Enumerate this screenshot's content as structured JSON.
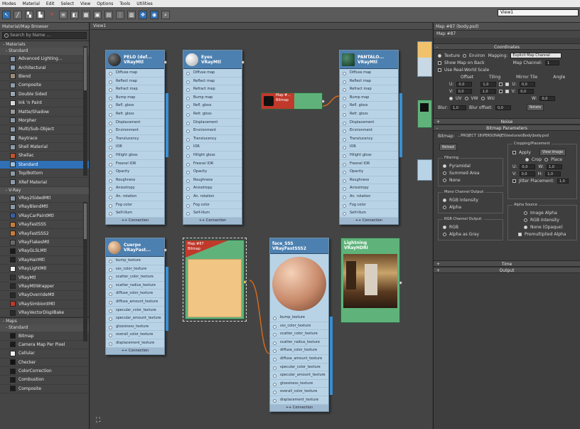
{
  "menu": [
    "Modes",
    "Material",
    "Edit",
    "Select",
    "View",
    "Options",
    "Tools",
    "Utilities"
  ],
  "view_name": "View1",
  "browser": {
    "title": "Material/Map Browser",
    "search_placeholder": "Search by Name ...",
    "groups": {
      "materials": "- Materials",
      "standard": "- Standard",
      "vray": "- V-Ray",
      "maps": "- Maps",
      "maps_standard": "- Standard"
    },
    "standard_items": [
      {
        "label": "Advanced Lighting...",
        "color": "#8a97a8"
      },
      {
        "label": "Architectural",
        "color": "#8ea0b3"
      },
      {
        "label": "Blend",
        "color": "#9b8b7a"
      },
      {
        "label": "Composite",
        "color": "#8d9aa7"
      },
      {
        "label": "Double Sided",
        "color": "#9aa6b1"
      },
      {
        "label": "Ink 'n Paint",
        "color": "#d8d8d8"
      },
      {
        "label": "Matte/Shadow",
        "color": "#9a9a9a"
      },
      {
        "label": "Morpher",
        "color": "#8d9aa7"
      },
      {
        "label": "Multi/Sub-Object",
        "color": "#8d9aa7"
      },
      {
        "label": "Raytrace",
        "color": "#a9b4bf"
      },
      {
        "label": "Shell Material",
        "color": "#8d9aa7"
      },
      {
        "label": "Shellac",
        "color": "#c2532b"
      },
      {
        "label": "Standard",
        "color": "#9cc0e0",
        "selected": true
      },
      {
        "label": "Top/Bottom",
        "color": "#8d9aa7"
      },
      {
        "label": "XRef Material",
        "color": "#8d9aa7"
      }
    ],
    "vray_items": [
      {
        "label": "VRay2SidedMtl",
        "color": "#8d9aa7"
      },
      {
        "label": "VRayBlendMtl",
        "color": "#8d9aa7"
      },
      {
        "label": "VRayCarPaintMtl",
        "color": "#3b5f9e"
      },
      {
        "label": "VRayFastSSS",
        "color": "#c97d3a"
      },
      {
        "label": "VRayFastSSS2",
        "color": "#c97d3a"
      },
      {
        "label": "VRayFlakesMtl",
        "color": "#6a6a6a"
      },
      {
        "label": "VRayGLSLMtl",
        "color": "#1a1a1a"
      },
      {
        "label": "VRayHairMtl",
        "color": "#222222"
      },
      {
        "label": "VRayLightMtl",
        "color": "#f0f0f0"
      },
      {
        "label": "VRayMtl",
        "color": "#333333"
      },
      {
        "label": "VRayMtlWrapper",
        "color": "#2a2a2a"
      },
      {
        "label": "VRayOverrideMtl",
        "color": "#2a2a2a"
      },
      {
        "label": "VRaySimbiontMtl",
        "color": "#c0392b"
      },
      {
        "label": "VRayVectorDisplBake",
        "color": "#2a2a2a"
      }
    ],
    "map_items": [
      {
        "label": "Bitmap",
        "color": "#1b1b1b"
      },
      {
        "label": "Camera Map Per Pixel",
        "color": "#1b1b1b"
      },
      {
        "label": "Cellular",
        "color": "#f2f2f2"
      },
      {
        "label": "Checker",
        "color": "#111111"
      },
      {
        "label": "ColorCorrection",
        "color": "#1b1b1b"
      },
      {
        "label": "Combustion",
        "color": "#1b1b1b"
      },
      {
        "label": "Composite",
        "color": "#1b1b1b"
      }
    ]
  },
  "view": {
    "title": "View1",
    "vray_slots": [
      "Diffuse map",
      "Reflect map",
      "Refract map",
      "Bump map",
      "Refl. gloss",
      "Refr. gloss",
      "Displacement",
      "Environment",
      "Translucency",
      "IOR",
      "Hilight gloss",
      "Fresnel IOR",
      "Opacity",
      "Roughness",
      "Anisotropy",
      "An. rotation",
      "Fog color",
      "Self-illum"
    ],
    "sss_slots_a": [
      "bump_texture",
      "sss_color_texture",
      "scatter_color_texture",
      "scatter_radius_texture",
      "diffuse_color_texture",
      "diffuse_amount_texture",
      "specular_color_texture",
      "specular_amount_texture",
      "glossiness_texture",
      "overall_color_texture",
      "displacement_texture"
    ],
    "sss_slots_b": [
      "bump_texture",
      "sss_color_texture",
      "scatter_color_texture",
      "scatter_radius_texture",
      "diffuse_color_texture",
      "diffuse_amount_texture",
      "specular_color_texture",
      "specular_amount_texture",
      "glossiness_texture",
      "overall_color_texture",
      "displacement_texture"
    ],
    "footer": "++ Connection",
    "nodes": {
      "pelo": {
        "title": "PELO (def...",
        "type": "VRayMtl"
      },
      "eyes": {
        "title": "Eyes",
        "type": "VRayMtl"
      },
      "pantalo": {
        "title": "PANTALO...",
        "type": "VRayMtl"
      },
      "map_small": {
        "title": "Map #...",
        "type": "Bitmap"
      },
      "cuerpo": {
        "title": "Cuerpo",
        "type": "VRayFast..."
      },
      "map87": {
        "title": "Map #87",
        "type": "Bitmap"
      },
      "face": {
        "title": "face_SSS",
        "type": "VRayFastSSS2"
      },
      "lightning": {
        "title": "Lightning",
        "type": "VRayHDRI"
      }
    },
    "colors": {
      "node_head": "#4c80b0",
      "node_body": "#b9d3e6",
      "bitmap_head": "#c0392b",
      "bitmap_body": "#5fb37a",
      "wire": "#d2691e",
      "skin": "#f1c584"
    }
  },
  "params": {
    "title": "Map #87 (body.psd)",
    "subtitle": "Map #87",
    "coordinates": "Coordinates",
    "texture_label": "Texture",
    "environ_label": "Environ",
    "mapping_label": "Mapping:",
    "mapping_value": "Explicit Map Channel",
    "map_channel_label": "Map Channel:",
    "map_channel_value": "1",
    "show_map_back": "Show Map on Back",
    "real_world": "Use Real-World Scale",
    "offset_h": "Offset",
    "tiling_h": "Tiling",
    "mirror_h": "Mirror Tile",
    "angle_h": "Angle",
    "u": "U:",
    "v": "V:",
    "w": "W:",
    "offset_u": "0,0",
    "offset_v": "0,0",
    "tiling_u": "1,0",
    "tiling_v": "1,0",
    "angle_u": "0,0",
    "angle_v": "0,0",
    "angle_w": "0,0",
    "uv": "UV",
    "vw": "VW",
    "wu": "WU",
    "blur_label": "Blur:",
    "blur_value": "1,0",
    "blur_offset_label": "Blur offset:",
    "blur_offset_value": "0,0",
    "rotate": "Rotate",
    "noise": "Noise",
    "bitmap_params": "Bitmap Parameters",
    "bitmap_label": "Bitmap:",
    "bitmap_path": "...PROJECT 18\\PERSONAJES\\texturas\\Body\\body.psd",
    "reload": "Reload",
    "cropping": "Cropping/Placement",
    "apply": "Apply",
    "view_image": "View Image",
    "crop": "Crop",
    "place": "Place",
    "crop_u": "0,0",
    "crop_v": "0,0",
    "crop_w": "1,0",
    "crop_h": "1,0",
    "jitter": "Jitter Placement:",
    "jitter_value": "1,0",
    "filtering": "Filtering",
    "pyramidal": "Pyramidal",
    "summed": "Summed Area",
    "none": "None",
    "mono_out": "Mono Channel Output:",
    "rgb_intensity": "RGB Intensity",
    "alpha": "Alpha",
    "alpha_source": "Alpha Source",
    "image_alpha": "Image Alpha",
    "rgb_int2": "RGB Intensity",
    "none_opaque": "None (Opaque)",
    "rgb_out": "RGB Channel Output:",
    "rgb": "RGB",
    "alpha_gray": "Alpha as Gray",
    "premult": "Premultiplied Alpha",
    "time": "Time",
    "output": "Output"
  }
}
